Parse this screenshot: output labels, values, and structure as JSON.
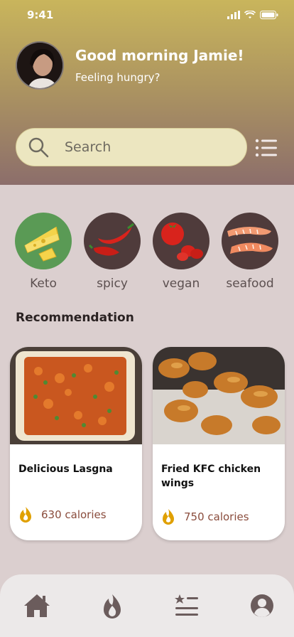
{
  "status_bar": {
    "time": "9:41"
  },
  "header": {
    "greeting": "Good morning Jamie!",
    "subtitle": "Feeling hungry?"
  },
  "search": {
    "placeholder": "Search"
  },
  "categories": [
    {
      "label": "Keto",
      "icon": "cheese-icon",
      "bg": "#5a9a55"
    },
    {
      "label": "spicy",
      "icon": "chili-pepper-icon",
      "bg": "#4f3b3b"
    },
    {
      "label": "vegan",
      "icon": "tomato-icon",
      "bg": "#4f3b3b"
    },
    {
      "label": "seafood",
      "icon": "shrimp-icon",
      "bg": "#4f3b3b"
    }
  ],
  "recommendation": {
    "title": "Recommendation",
    "cards": [
      {
        "title": "Delicious Lasgna",
        "calories": "630 calories",
        "icon": "flame-icon"
      },
      {
        "title": "Fried KFC chicken wings",
        "calories": "750 calories",
        "icon": "flame-icon"
      }
    ]
  },
  "nav": [
    "home-icon",
    "flame-icon",
    "list-icon",
    "profile-icon"
  ],
  "colors": {
    "accent": "#c9b55c",
    "flame": "#e0a000",
    "calorie_text": "#8a4c3c"
  }
}
